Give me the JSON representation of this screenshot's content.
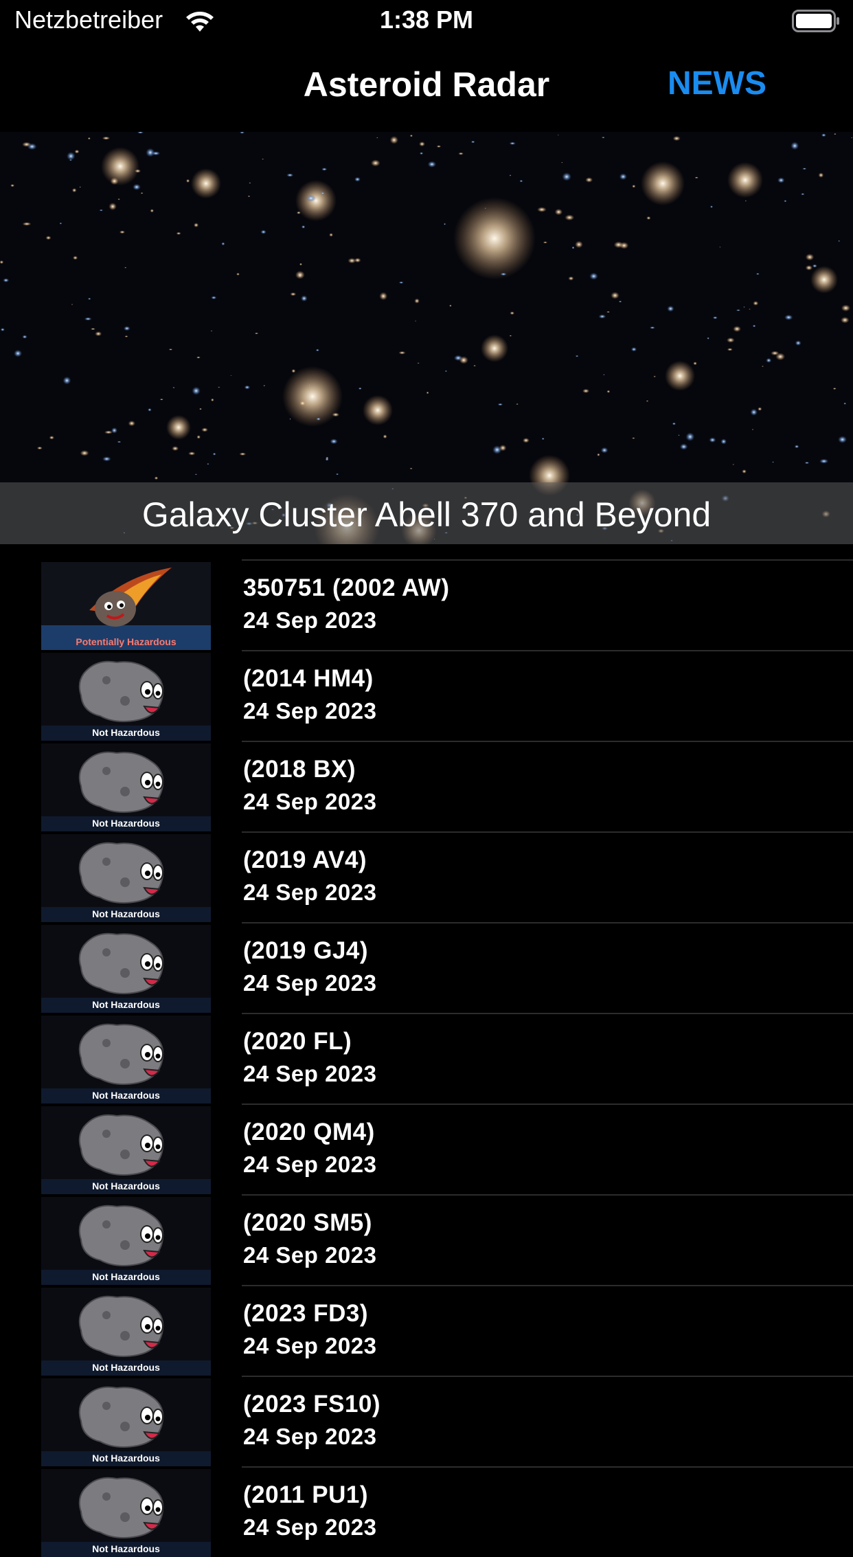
{
  "status_bar": {
    "carrier": "Netzbetreiber",
    "time": "1:38 PM",
    "icons": [
      "wifi-icon",
      "battery-icon"
    ]
  },
  "nav": {
    "title": "Asteroid Radar",
    "news_label": "NEWS",
    "accent_color": "#1a8cf0"
  },
  "image_of_day": {
    "caption": "Galaxy Cluster Abell 370 and Beyond"
  },
  "asteroids": [
    {
      "name": "350751 (2002 AW)",
      "date": "24 Sep 2023",
      "status": "Potentially Hazardous",
      "hazardous": true
    },
    {
      "name": "(2014 HM4)",
      "date": "24 Sep 2023",
      "status": "Not Hazardous",
      "hazardous": false
    },
    {
      "name": "(2018 BX)",
      "date": "24 Sep 2023",
      "status": "Not Hazardous",
      "hazardous": false
    },
    {
      "name": "(2019 AV4)",
      "date": "24 Sep 2023",
      "status": "Not Hazardous",
      "hazardous": false
    },
    {
      "name": "(2019 GJ4)",
      "date": "24 Sep 2023",
      "status": "Not Hazardous",
      "hazardous": false
    },
    {
      "name": "(2020 FL)",
      "date": "24 Sep 2023",
      "status": "Not Hazardous",
      "hazardous": false
    },
    {
      "name": "(2020 QM4)",
      "date": "24 Sep 2023",
      "status": "Not Hazardous",
      "hazardous": false
    },
    {
      "name": "(2020 SM5)",
      "date": "24 Sep 2023",
      "status": "Not Hazardous",
      "hazardous": false
    },
    {
      "name": "(2023 FD3)",
      "date": "24 Sep 2023",
      "status": "Not Hazardous",
      "hazardous": false
    },
    {
      "name": "(2023 FS10)",
      "date": "24 Sep 2023",
      "status": "Not Hazardous",
      "hazardous": false
    },
    {
      "name": "(2011 PU1)",
      "date": "24 Sep 2023",
      "status": "Not Hazardous",
      "hazardous": false
    }
  ]
}
